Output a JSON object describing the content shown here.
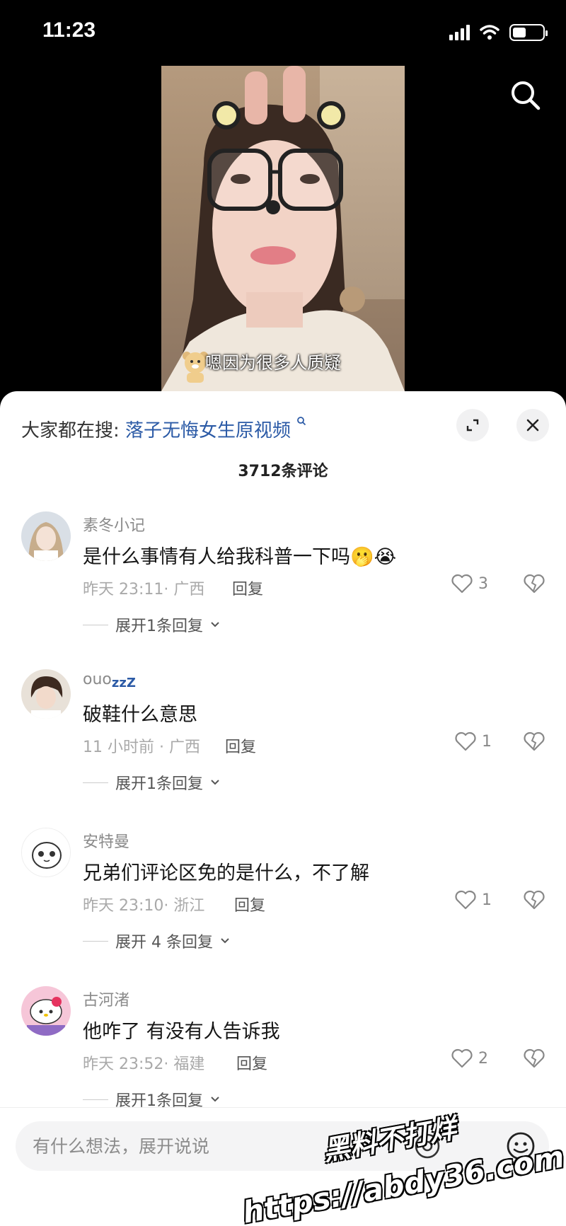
{
  "status_bar": {
    "time": "11:23",
    "battery_level": 0.45
  },
  "video": {
    "caption": "嗯因为很多人质疑"
  },
  "sheet": {
    "search_prefix": "大家都在搜:",
    "search_keyword": "落子无悔女生原视频",
    "comment_count": "3712条评论"
  },
  "comments": [
    {
      "user": "素冬小记",
      "text": "是什么事情有人给我科普一下吗",
      "emojis": "🫢😭",
      "meta": "昨天 23:11· 广西",
      "reply": "回复",
      "likes": "3",
      "expand": "展开1条回复"
    },
    {
      "user": "ouo",
      "user_suffix": "zzZ",
      "text": "破鞋什么意思",
      "emojis": "",
      "meta": "11 小时前 · 广西",
      "reply": "回复",
      "likes": "1",
      "expand": "展开1条回复"
    },
    {
      "user": "安特曼",
      "text": "兄弟们评论区免的是什么，不了解",
      "emojis": "",
      "meta": "昨天 23:10· 浙江",
      "reply": "回复",
      "likes": "1",
      "expand": "展开 4 条回复"
    },
    {
      "user": "古河渚",
      "text": "他咋了 有没有人告诉我",
      "emojis": "",
      "meta": "昨天 23:52· 福建",
      "reply": "回复",
      "likes": "2",
      "expand": "展开1条回复"
    }
  ],
  "input": {
    "placeholder": "有什么想法，展开说说"
  },
  "watermark": {
    "line1": "黑料不打烊",
    "line2": "https://abdy36.com"
  }
}
